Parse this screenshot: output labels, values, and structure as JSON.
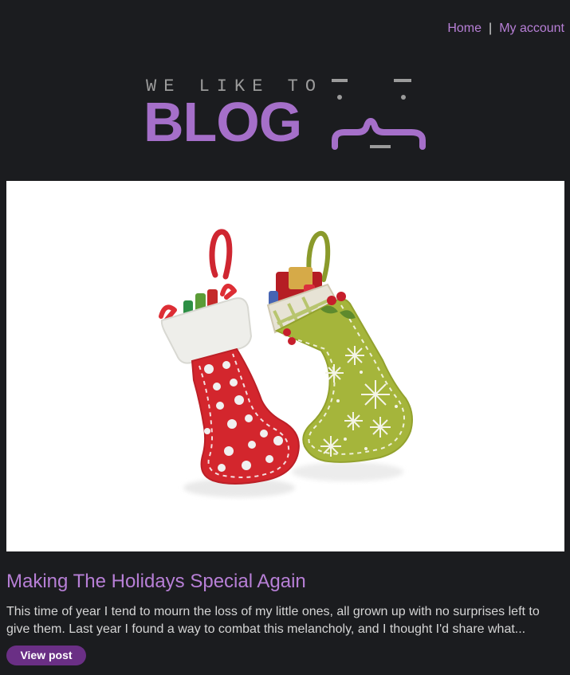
{
  "nav": {
    "home": "Home",
    "separator": "|",
    "account": "My account"
  },
  "logo": {
    "top_text": "WE LIKE TO",
    "main_text": "BLOG"
  },
  "post": {
    "image_subject": "christmas-stockings",
    "title": "Making The Holidays Special Again",
    "summary": "This time of year I tend to mourn the loss of my little ones, all grown up with no surprises left to give them. Last year I found a way to combat this melancholy, and I thought I'd share what...",
    "button_label": "View post"
  },
  "colors": {
    "background": "#1b1c1f",
    "accent": "#b77fd6",
    "logo_accent": "#a56fc9",
    "button": "#6a2f85",
    "text": "#d5d5d5"
  }
}
